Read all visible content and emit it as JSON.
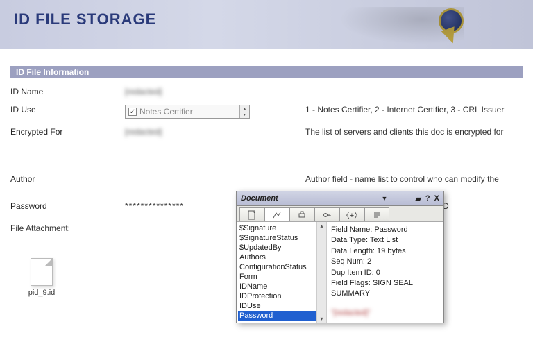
{
  "banner": {
    "title": "ID FILE STORAGE"
  },
  "section": {
    "title": "ID File  Information"
  },
  "rows": {
    "idname": {
      "label": "ID Name",
      "value": "[redacted]"
    },
    "iduse": {
      "label": "ID Use",
      "selected": "Notes Certifier",
      "desc": "1 - Notes Certifier, 2 - Internet Certifier, 3 - CRL Issuer"
    },
    "encrypted": {
      "label": "Encrypted For",
      "value": "[redacted]",
      "desc": "The list of servers and clients this doc is encrypted for"
    },
    "author": {
      "label": "Author",
      "desc": "Author field - name list to control who can modify the"
    },
    "password": {
      "label": "Password",
      "value": "***************",
      "desc": "lock ID"
    }
  },
  "attach": {
    "label": "File Attachment:",
    "filename": "pid_9.id"
  },
  "panel": {
    "title": "Document",
    "controls": {
      "min": "▰",
      "help": "?",
      "close": "X"
    },
    "tabs": [
      "page",
      "fields",
      "print",
      "key",
      "plus",
      "para"
    ],
    "fields": [
      "$Signature",
      "$SignatureStatus",
      "$UpdatedBy",
      "Authors",
      "ConfigurationStatus",
      "Form",
      "IDName",
      "IDProtection",
      "IDUse",
      "Password"
    ],
    "selectedIndex": 9,
    "detail": {
      "l1": "Field Name: Password",
      "l2": "Data Type: Text List",
      "l3": "Data Length: 19 bytes",
      "l4": "Seq Num: 2",
      "l5": "Dup Item ID: 0",
      "l6": "Field Flags: SIGN SEAL",
      "l7": "SUMMARY",
      "l8": "\"[redacted]\""
    }
  }
}
